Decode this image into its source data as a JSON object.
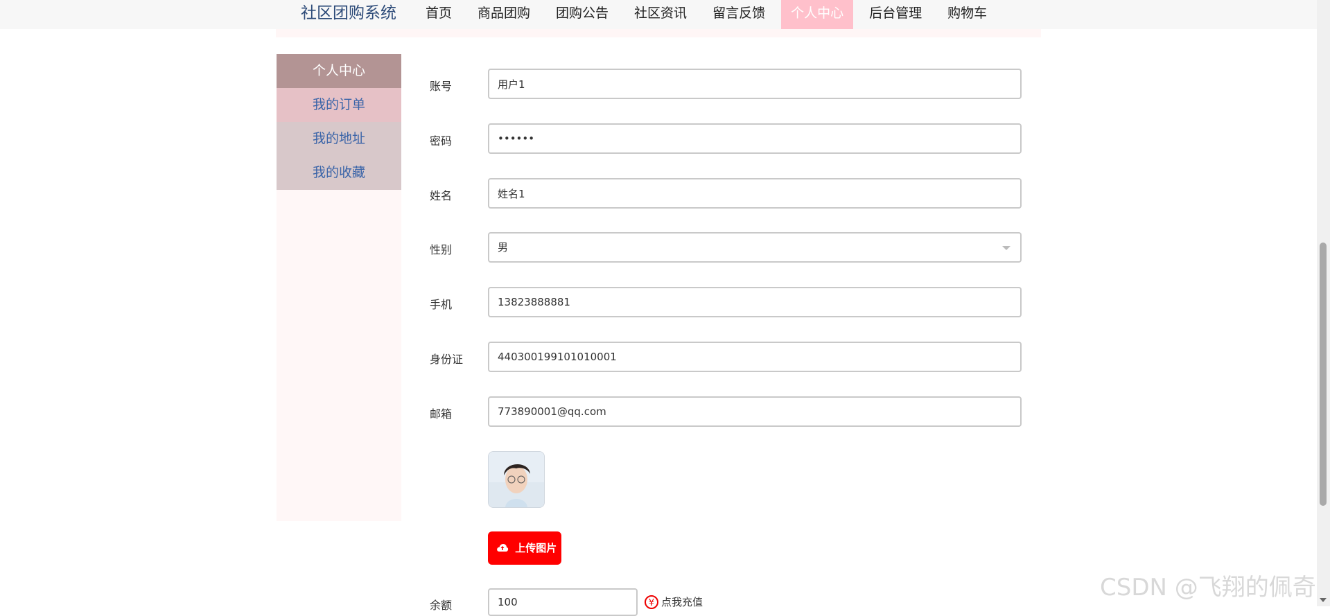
{
  "brand": "社区团购系统",
  "nav": [
    {
      "label": "首页"
    },
    {
      "label": "商品团购"
    },
    {
      "label": "团购公告"
    },
    {
      "label": "社区资讯"
    },
    {
      "label": "留言反馈"
    },
    {
      "label": "个人中心",
      "active": true
    },
    {
      "label": "后台管理"
    },
    {
      "label": "购物车"
    }
  ],
  "sidebar": {
    "items": [
      {
        "label": "个人中心"
      },
      {
        "label": "我的订单"
      },
      {
        "label": "我的地址"
      },
      {
        "label": "我的收藏"
      }
    ]
  },
  "form": {
    "account": {
      "label": "账号",
      "value": "用户1"
    },
    "password": {
      "label": "密码",
      "value": "••••••"
    },
    "name": {
      "label": "姓名",
      "value": "姓名1"
    },
    "gender": {
      "label": "性别",
      "value": "男"
    },
    "phone": {
      "label": "手机",
      "value": "13823888881"
    },
    "idcard": {
      "label": "身份证",
      "value": "440300199101010001"
    },
    "email": {
      "label": "邮箱",
      "value": "773890001@qq.com"
    },
    "upload_label": "上传图片",
    "balance": {
      "label": "余额",
      "value": "100"
    },
    "recharge_icon": "¥",
    "recharge_label": "点我充值"
  },
  "watermark": "CSDN @飞翔的佩奇",
  "colors": {
    "upload": "#ff0000",
    "nav_active": "#ffc0cb",
    "sidebar_active": "#b39494"
  }
}
